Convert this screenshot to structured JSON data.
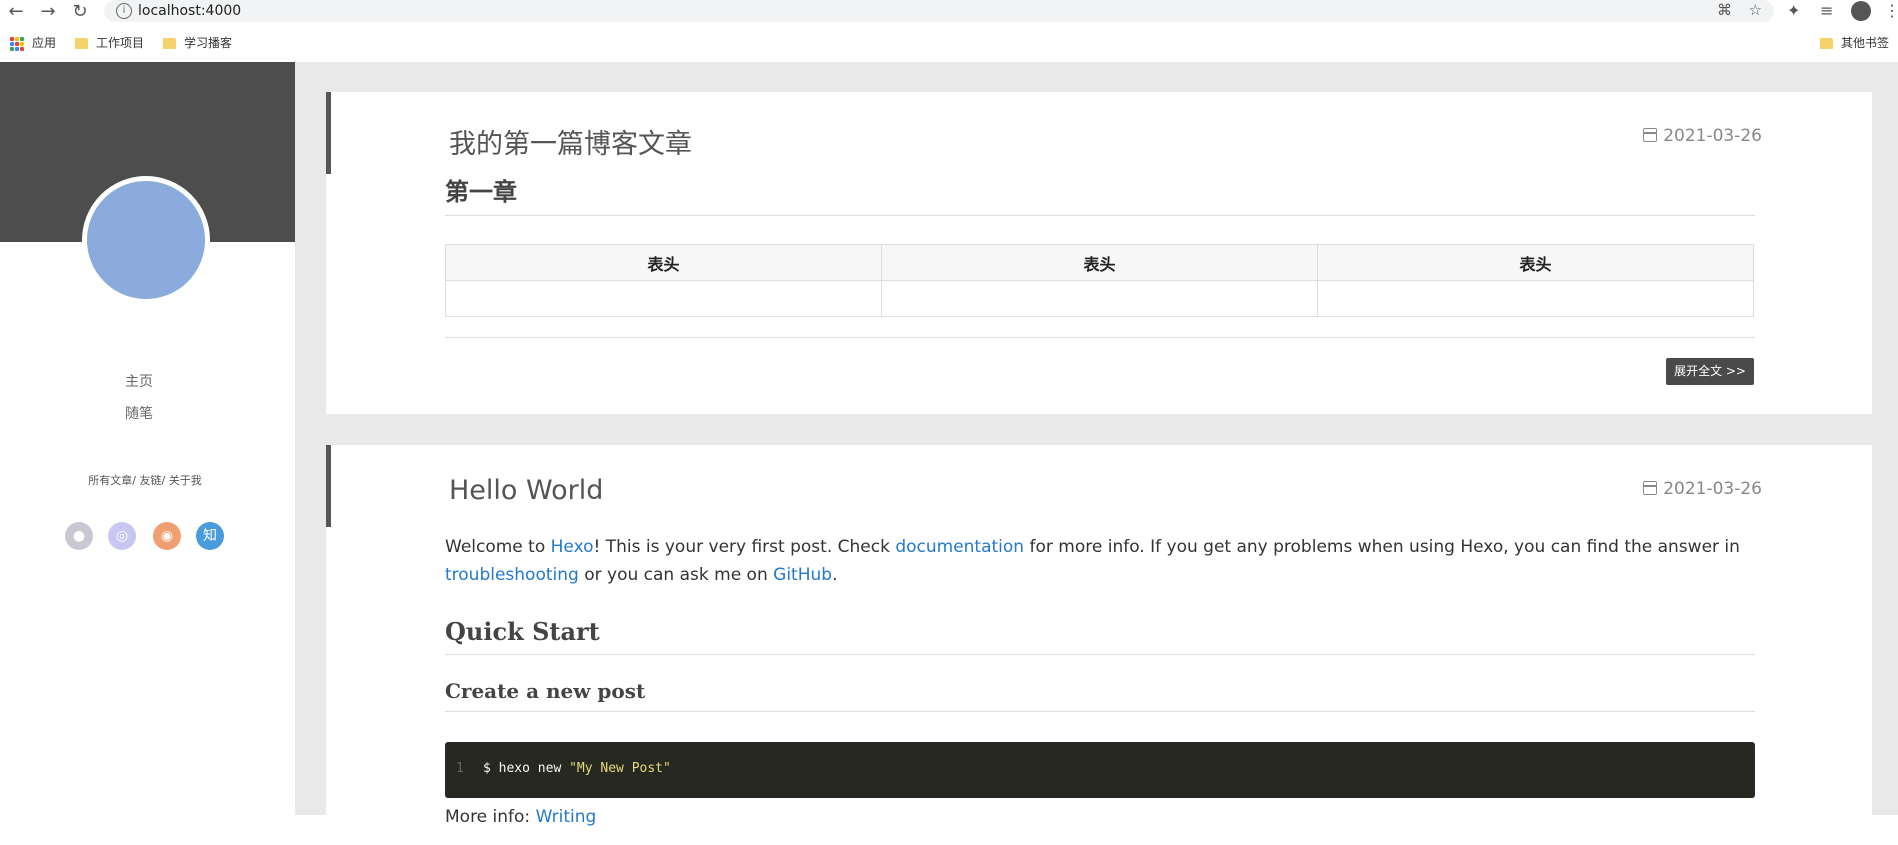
{
  "browser": {
    "url": "localhost:4000",
    "bookmarks": [
      "应用",
      "工作项目",
      "学习播客",
      "其他书签"
    ]
  },
  "sidebar": {
    "nav": [
      "主页",
      "随笔"
    ],
    "links": [
      "所有文章",
      "友链",
      "关于我"
    ],
    "link_separator": "/",
    "social": [
      {
        "icon": "github-icon",
        "glyph": "●",
        "color": "#c8c8d0"
      },
      {
        "icon": "weibo-icon",
        "glyph": "◎",
        "color": "#c9c6f2"
      },
      {
        "icon": "rss-icon",
        "glyph": "◉",
        "color": "#f0a070"
      },
      {
        "icon": "zhihu-icon",
        "glyph": "知",
        "color": "#4a9bdb"
      }
    ]
  },
  "posts": [
    {
      "title": "我的第一篇博客文章",
      "date": "2021-03-26",
      "heading": "第一章",
      "table_headers": [
        "表头",
        "表头",
        "表头"
      ],
      "more_label": "展开全文 >>"
    },
    {
      "title": "Hello World",
      "date": "2021-03-26",
      "intro": {
        "t1": "Welcome to ",
        "l1": "Hexo",
        "t2": "! This is your very first post. Check ",
        "l2": "documentation",
        "t3": " for more info. If you get any problems when using Hexo, you can find the answer in ",
        "l3": "troubleshooting",
        "t4": " or you can ask me on ",
        "l4": "GitHub",
        "t5": "."
      },
      "section": "Quick Start",
      "subsection": "Create a new post",
      "code": {
        "line_no": "1",
        "cmd": "$ hexo new ",
        "arg": "\"My New Post\""
      },
      "more_info": {
        "label": "More info: ",
        "link": "Writing"
      }
    }
  ]
}
